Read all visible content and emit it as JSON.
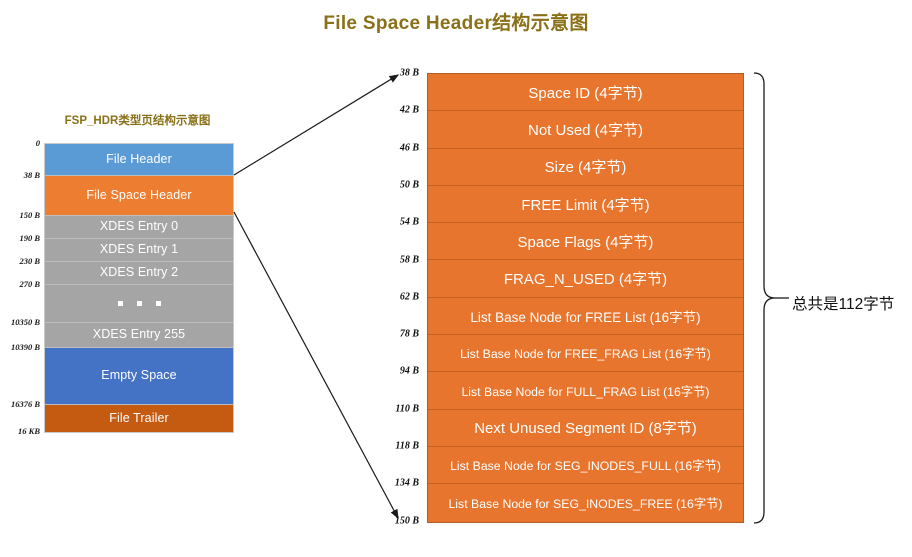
{
  "title": "File Space Header结构示意图",
  "left_panel": {
    "subtitle": "FSP_HDR类型页结构示意图",
    "blocks": [
      {
        "label": "File Header",
        "offset": "0",
        "color": "#5B9BD5"
      },
      {
        "label": "File Space Header",
        "offset": "38 B",
        "color": "#ED7D31"
      },
      {
        "label": "XDES Entry 0",
        "offset": "150 B",
        "color": "#A5A5A5"
      },
      {
        "label": "XDES Entry 1",
        "offset": "190 B",
        "color": "#A5A5A5"
      },
      {
        "label": "XDES Entry 2",
        "offset": "230 B",
        "color": "#A5A5A5"
      },
      {
        "label": "",
        "offset": "270 B",
        "color": "#A5A5A5"
      },
      {
        "label": "XDES Entry 255",
        "offset": "10350 B",
        "color": "#A5A5A5"
      },
      {
        "label": "Empty Space",
        "offset": "10390 B",
        "color": "#4472C4"
      },
      {
        "label": "File Trailer",
        "offset": "16376 B",
        "color": "#C55A11"
      }
    ],
    "bottom_offset": "16 KB"
  },
  "fsp_table": {
    "rows": [
      {
        "offset": "38 B",
        "label": "Space ID (4字节)"
      },
      {
        "offset": "42 B",
        "label": "Not Used (4字节)"
      },
      {
        "offset": "46 B",
        "label": "Size (4字节)"
      },
      {
        "offset": "50 B",
        "label": "FREE Limit (4字节)"
      },
      {
        "offset": "54 B",
        "label": "Space Flags (4字节)"
      },
      {
        "offset": "58 B",
        "label": "FRAG_N_USED (4字节)"
      },
      {
        "offset": "62 B",
        "label": "List Base Node for FREE List (16字节)"
      },
      {
        "offset": "78 B",
        "label": "List Base Node for FREE_FRAG List (16字节)"
      },
      {
        "offset": "94 B",
        "label": "List Base Node for FULL_FRAG List (16字节)"
      },
      {
        "offset": "110 B",
        "label": "Next Unused Segment ID  (8字节)"
      },
      {
        "offset": "118 B",
        "label": "List Base Node for SEG_INODES_FULL (16字节)"
      },
      {
        "offset": "134 B",
        "label": "List Base Node for SEG_INODES_FREE (16字节)"
      }
    ],
    "end_offset": "150 B",
    "total_label": "总共是112字节",
    "fill_color": "#E8752E"
  }
}
